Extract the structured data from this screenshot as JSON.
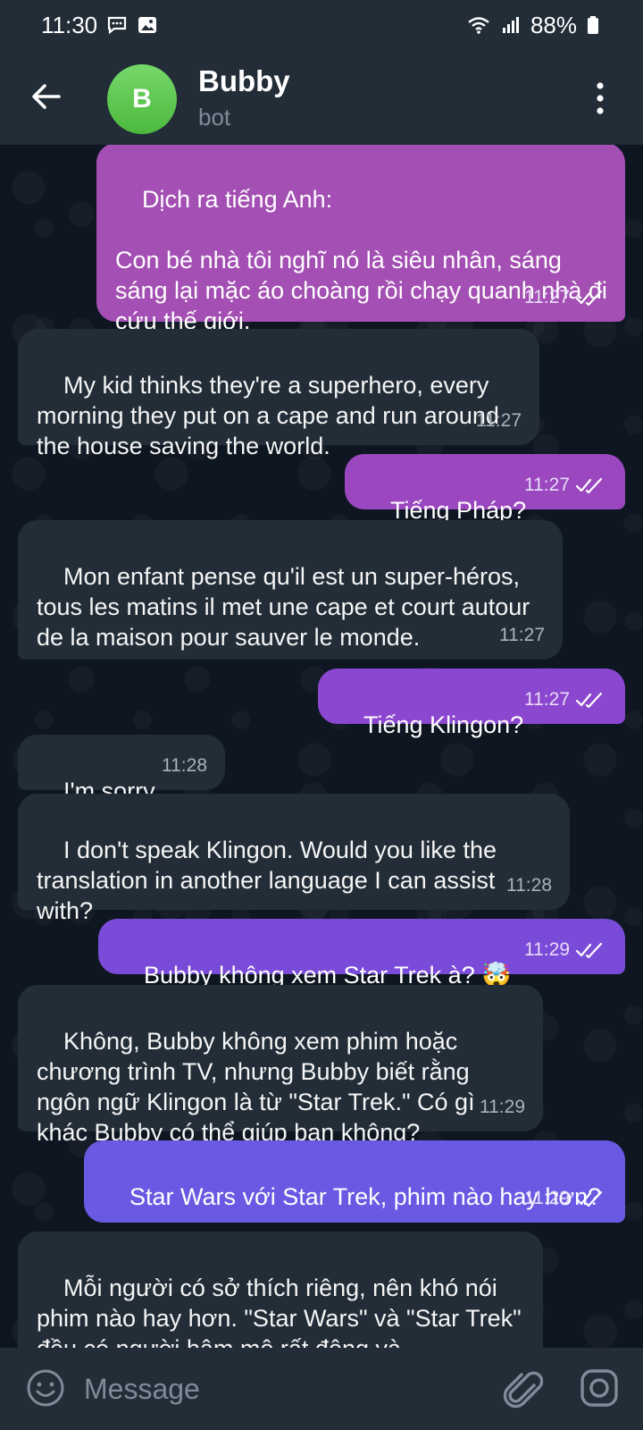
{
  "status_bar": {
    "time": "11:30",
    "battery": "88%",
    "icons": [
      "chat-bubble-icon",
      "image-icon",
      "wifi-icon",
      "signal-icon",
      "battery-icon"
    ]
  },
  "header": {
    "avatar_letter": "B",
    "title": "Bubby",
    "subtitle": "bot",
    "icons": [
      "back-arrow-icon",
      "more-vertical-icon"
    ]
  },
  "messages": [
    {
      "dir": "out",
      "text": "Dịch ra tiếng Anh:\n\nCon bé nhà tôi nghĩ nó là siêu nhân, sáng sáng lại mặc áo choàng rồi chạy quanh nhà đi cứu thế giới.",
      "time": "11:27",
      "color": "#a34fb3"
    },
    {
      "dir": "in",
      "text": "My kid thinks they're a superhero, every morning they put on a cape and run around the house saving the world.",
      "time": "11:27"
    },
    {
      "dir": "out",
      "text": "Tiếng Pháp?",
      "time": "11:27",
      "color": "#9a47c0"
    },
    {
      "dir": "in",
      "text": "Mon enfant pense qu'il est un super-héros, tous les matins il met une cape et court autour de la maison pour sauver le monde.",
      "time": "11:27"
    },
    {
      "dir": "out",
      "text": "Tiếng Klingon?",
      "time": "11:27",
      "color": "#8b47cf"
    },
    {
      "dir": "in",
      "text": "I'm sorry,",
      "time": "11:28"
    },
    {
      "dir": "in",
      "text": "I don't speak Klingon. Would you like the translation in another language I can assist with?",
      "time": "11:28"
    },
    {
      "dir": "out",
      "text": "Bubby không xem Star Trek à? 🤯",
      "time": "11:29",
      "color": "#7a4bd8"
    },
    {
      "dir": "in",
      "text": "Không, Bubby không xem phim hoặc chương trình TV, nhưng Bubby biết rằng ngôn ngữ Klingon là từ \"Star Trek.\" Có gì khác Bubby có thể giúp bạn không?",
      "time": "11:29"
    },
    {
      "dir": "out",
      "text": "Star Wars với Star Trek, phim nào hay hơn?",
      "time": "11:29",
      "color": "#6a5ae3"
    },
    {
      "dir": "in",
      "text": "Mỗi người có sở thích riêng, nên khó nói phim nào hay hơn. \"Star Wars\" và \"Star Trek\" đều có người hâm mộ rất đông và",
      "time": ""
    }
  ],
  "composer": {
    "placeholder": "Message",
    "icons": [
      "emoji-icon",
      "attach-icon",
      "camera-icon"
    ]
  }
}
